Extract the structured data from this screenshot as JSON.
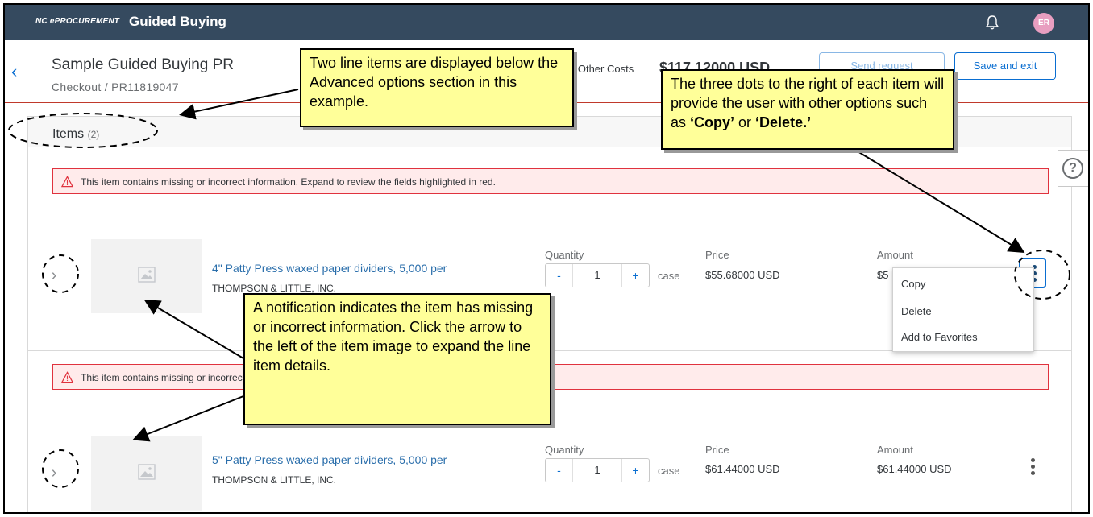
{
  "shell": {
    "brand_small": "NC ePROCUREMENT",
    "brand_title": "Guided Buying",
    "avatar_initials": "ER"
  },
  "header": {
    "back_icon": "chevron-left",
    "title": "Sample Guided Buying PR",
    "breadcrumb": "Checkout  /  PR11819047",
    "costs_label": "d Other Costs",
    "costs_value": "$117.12000 USD",
    "send_label": "Send request",
    "save_label": "Save and exit"
  },
  "items": {
    "title": "Items",
    "count": "(2)",
    "warning_text": "This item contains missing or incorrect information. Expand to review the fields highlighted in red.",
    "quantity_label": "Quantity",
    "price_label": "Price",
    "amount_label": "Amount",
    "rows": [
      {
        "name": "4\" Patty Press waxed paper dividers, 5,000 per",
        "vendor": "THOMPSON & LITTLE, INC.",
        "quantity": "1",
        "unit": "case",
        "price": "$55.68000 USD",
        "amount": "$5"
      },
      {
        "name": "5\" Patty Press waxed paper dividers, 5,000 per",
        "vendor": "THOMPSON & LITTLE, INC.",
        "quantity": "1",
        "unit": "case",
        "price": "$61.44000 USD",
        "amount": "$61.44000 USD"
      }
    ]
  },
  "menu": {
    "items": [
      "Copy",
      "Delete",
      "Add to Favorites"
    ]
  },
  "stepper": {
    "minus": "-",
    "plus": "+"
  },
  "help_label": "?",
  "callouts": {
    "line_items": "Two line items are displayed below the Advanced options section in this example.",
    "three_dots_a": "The three dots to the right of each item will provide the user with other options such as ",
    "three_dots_copy": "‘Copy’",
    "three_dots_or": " or ",
    "three_dots_delete": "‘Delete.’",
    "notification": "A notification indicates the item has missing or incorrect information.  Click the arrow to the left of the item image to expand the line item details."
  },
  "colors": {
    "shellbar": "#354a5f",
    "accent": "#0a6ed1",
    "warning_border": "#e0323e",
    "warning_bg": "#ffebeb",
    "callout_bg": "#ffff99"
  }
}
